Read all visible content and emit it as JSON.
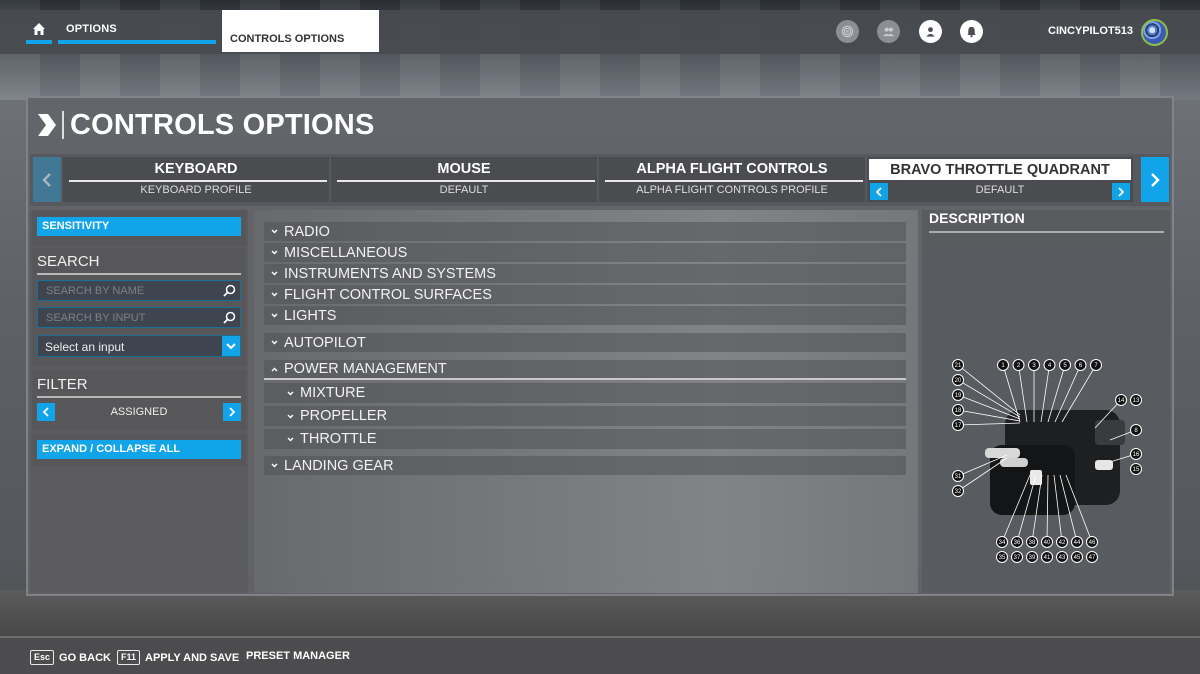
{
  "topbar": {
    "home_icon": "home-icon",
    "options_label": "OPTIONS",
    "controls_options_label": "CONTROLS OPTIONS",
    "icons": [
      "activity-icon",
      "friends-icon",
      "profile-icon",
      "notifications-bell-icon"
    ],
    "username": "CINCYPILOT513"
  },
  "page": {
    "title": "CONTROLS OPTIONS"
  },
  "devices": [
    {
      "name": "KEYBOARD",
      "profile": "KEYBOARD PROFILE",
      "active": false
    },
    {
      "name": "MOUSE",
      "profile": "DEFAULT",
      "active": false
    },
    {
      "name": "ALPHA FLIGHT CONTROLS",
      "profile": "ALPHA FLIGHT CONTROLS PROFILE",
      "active": false
    },
    {
      "name": "BRAVO THROTTLE QUADRANT",
      "profile": "DEFAULT",
      "active": true
    }
  ],
  "sidebar": {
    "sensitivity_label": "SENSITIVITY",
    "search_heading": "SEARCH",
    "search_by_name_placeholder": "SEARCH BY NAME",
    "search_by_input_placeholder": "SEARCH BY INPUT",
    "select_input_value": "Select an input",
    "filter_heading": "FILTER",
    "filter_value": "ASSIGNED",
    "expand_collapse_label": "EXPAND / COLLAPSE ALL"
  },
  "categories": [
    {
      "label": "RADIO",
      "expanded": false,
      "level": 0
    },
    {
      "label": "MISCELLANEOUS",
      "expanded": false,
      "level": 0
    },
    {
      "label": "INSTRUMENTS AND SYSTEMS",
      "expanded": false,
      "level": 0
    },
    {
      "label": "FLIGHT CONTROL SURFACES",
      "expanded": false,
      "level": 0
    },
    {
      "label": "LIGHTS",
      "expanded": false,
      "level": 0
    },
    {
      "label": "AUTOPILOT",
      "expanded": false,
      "level": 0
    },
    {
      "label": "POWER MANAGEMENT",
      "expanded": true,
      "level": 0
    },
    {
      "label": "MIXTURE",
      "expanded": false,
      "level": 1
    },
    {
      "label": "PROPELLER",
      "expanded": false,
      "level": 1
    },
    {
      "label": "THROTTLE",
      "expanded": false,
      "level": 1
    },
    {
      "label": "LANDING GEAR",
      "expanded": false,
      "level": 0
    }
  ],
  "description": {
    "title": "DESCRIPTION",
    "diagram_labels": {
      "top": [
        "1",
        "2",
        "3",
        "4",
        "5",
        "6",
        "7"
      ],
      "left": [
        "21",
        "20",
        "19",
        "18",
        "17"
      ],
      "right": [
        "14",
        "13",
        "8",
        "16",
        "15"
      ],
      "left_lower": [
        "31",
        "32"
      ],
      "bottom_row1": [
        "34",
        "36",
        "38",
        "40",
        "42",
        "44",
        "46"
      ],
      "bottom_row2": [
        "35",
        "37",
        "39",
        "41",
        "43",
        "45",
        "47"
      ]
    }
  },
  "bottombar": {
    "go_back_key": "Esc",
    "go_back_label": "GO BACK",
    "apply_key": "F11",
    "apply_label": "APPLY AND SAVE",
    "preset_label": "PRESET MANAGER"
  },
  "colors": {
    "accent": "#12a4e8"
  }
}
